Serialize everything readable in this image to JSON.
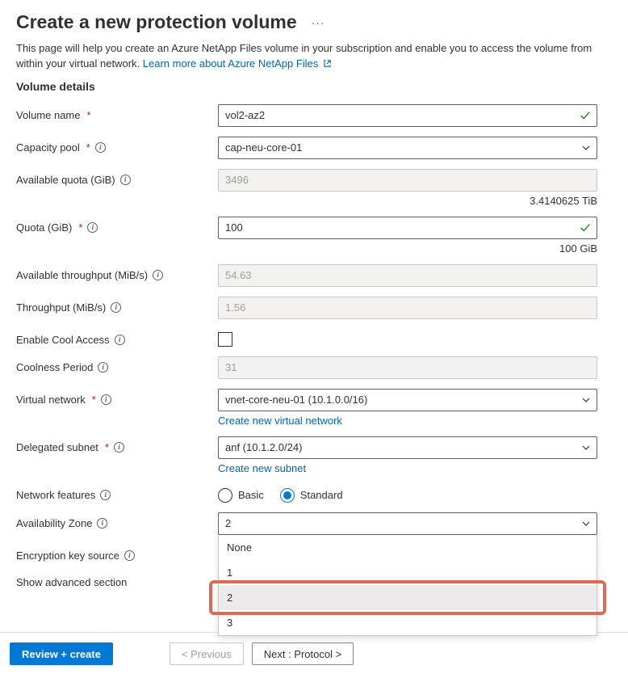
{
  "header": {
    "title": "Create a new protection volume"
  },
  "intro": {
    "text_part1": "This page will help you create an Azure NetApp Files volume in your subscription and enable you to access the volume from within your virtual network. ",
    "link_text": "Learn more about Azure NetApp Files"
  },
  "section": {
    "heading": "Volume details"
  },
  "fields": {
    "volume_name": {
      "label": "Volume name",
      "value": "vol2-az2"
    },
    "capacity_pool": {
      "label": "Capacity pool",
      "value": "cap-neu-core-01"
    },
    "available_quota": {
      "label": "Available quota (GiB)",
      "value": "3496",
      "sub": "3.4140625 TiB"
    },
    "quota": {
      "label": "Quota (GiB)",
      "value": "100",
      "sub": "100 GiB"
    },
    "available_throughput": {
      "label": "Available throughput (MiB/s)",
      "value": "54.63"
    },
    "throughput": {
      "label": "Throughput (MiB/s)",
      "value": "1.56"
    },
    "cool_access": {
      "label": "Enable Cool Access"
    },
    "coolness_period": {
      "label": "Coolness Period",
      "value": "31"
    },
    "virtual_network": {
      "label": "Virtual network",
      "value": "vnet-core-neu-01 (10.1.0.0/16)",
      "create_link": "Create new virtual network"
    },
    "delegated_subnet": {
      "label": "Delegated subnet",
      "value": "anf (10.1.2.0/24)",
      "create_link": "Create new subnet"
    },
    "network_features": {
      "label": "Network features",
      "options": {
        "basic": "Basic",
        "standard": "Standard"
      }
    },
    "availability_zone": {
      "label": "Availability Zone",
      "value": "2",
      "options": [
        "None",
        "1",
        "2",
        "3"
      ]
    },
    "encryption_key_source": {
      "label": "Encryption key source"
    },
    "show_advanced": {
      "label": "Show advanced section"
    }
  },
  "footer": {
    "review_create": "Review + create",
    "previous": "< Previous",
    "next": "Next : Protocol >"
  }
}
